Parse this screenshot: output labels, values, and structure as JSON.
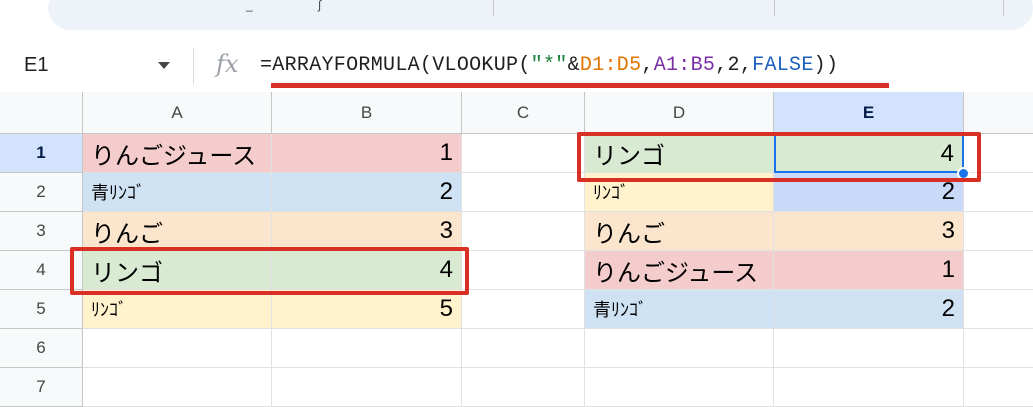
{
  "toolbar": {
    "glyph_a": "_",
    "glyph_b": "∫"
  },
  "formula_bar": {
    "name_box": "E1",
    "fx_label": "fx",
    "formula_parts": {
      "p1": "=ARRAYFORMULA(VLOOKUP(",
      "p2": "\"*\"",
      "p3": "&",
      "p4": "D1:D5",
      "p5": ",",
      "p6": "A1:B5",
      "p7": ",",
      "p8": "2",
      "p9": ",",
      "p10": "FALSE",
      "p11": "))"
    }
  },
  "columns": [
    "A",
    "B",
    "C",
    "D",
    "E"
  ],
  "rows": [
    "1",
    "2",
    "3",
    "4",
    "5",
    "6",
    "7"
  ],
  "selected_cell": "E1",
  "cells": {
    "A1": "りんごジュース",
    "B1": "1",
    "A2": "青ﾘﾝｺﾞ",
    "B2": "2",
    "A3": "りんご",
    "B3": "3",
    "A4": "リンゴ",
    "B4": "4",
    "A5": "ﾘﾝｺﾞ",
    "B5": "5",
    "D1": "リンゴ",
    "E1": "4",
    "D2": "ﾘﾝｺﾞ",
    "E2": "2",
    "D3": "りんご",
    "E3": "3",
    "D4": "りんごジュース",
    "E4": "1",
    "D5": "青ﾘﾝｺﾞ",
    "E5": "2"
  },
  "colors": {
    "pink": "#f4cccc",
    "blue": "#cfe2f3",
    "orange": "#fce5cd",
    "green": "#d9ead3",
    "yellow": "#fff2cc",
    "highlight_red": "#d93025",
    "selection_blue": "#1a73e8"
  }
}
